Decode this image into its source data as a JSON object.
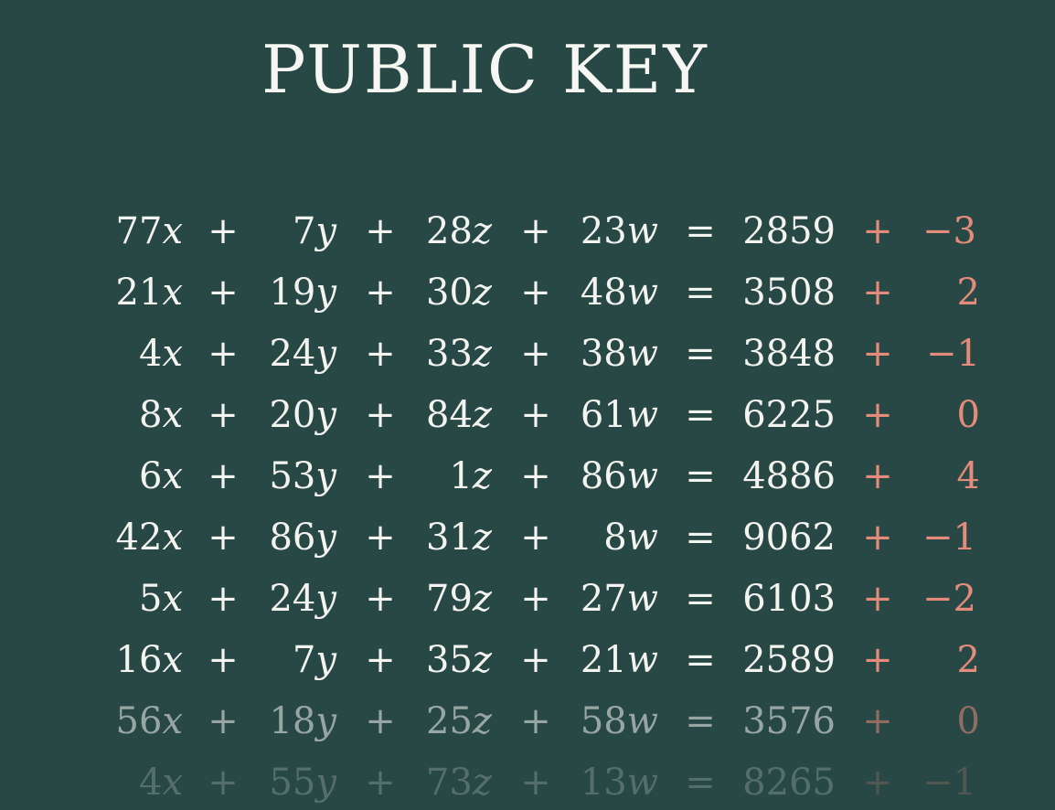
{
  "title": "PUBLIC KEY",
  "operators": {
    "plus": "+",
    "equals": "="
  },
  "variables": [
    "x",
    "y",
    "z",
    "w"
  ],
  "colors": {
    "background": "#284845",
    "text": "#f3f3ef",
    "noise": "#e58b7c"
  },
  "equations": [
    {
      "coefficients": [
        "77",
        "7",
        "28",
        "23"
      ],
      "result": "2859",
      "noise": "−3",
      "visibility": 1.0
    },
    {
      "coefficients": [
        "21",
        "19",
        "30",
        "48"
      ],
      "result": "3508",
      "noise": "2",
      "visibility": 1.0
    },
    {
      "coefficients": [
        "4",
        "24",
        "33",
        "38"
      ],
      "result": "3848",
      "noise": "−1",
      "visibility": 1.0
    },
    {
      "coefficients": [
        "8",
        "20",
        "84",
        "61"
      ],
      "result": "6225",
      "noise": "0",
      "visibility": 1.0
    },
    {
      "coefficients": [
        "6",
        "53",
        "1",
        "86"
      ],
      "result": "4886",
      "noise": "4",
      "visibility": 1.0
    },
    {
      "coefficients": [
        "42",
        "86",
        "31",
        "8"
      ],
      "result": "9062",
      "noise": "−1",
      "visibility": 1.0
    },
    {
      "coefficients": [
        "5",
        "24",
        "79",
        "27"
      ],
      "result": "6103",
      "noise": "−2",
      "visibility": 1.0
    },
    {
      "coefficients": [
        "16",
        "7",
        "35",
        "21"
      ],
      "result": "2589",
      "noise": "2",
      "visibility": 1.0
    },
    {
      "coefficients": [
        "56",
        "18",
        "25",
        "58"
      ],
      "result": "3576",
      "noise": "0",
      "visibility": 0.55
    },
    {
      "coefficients": [
        "4",
        "55",
        "73",
        "13"
      ],
      "result": "8265",
      "noise": "−1",
      "visibility": 0.22
    }
  ]
}
